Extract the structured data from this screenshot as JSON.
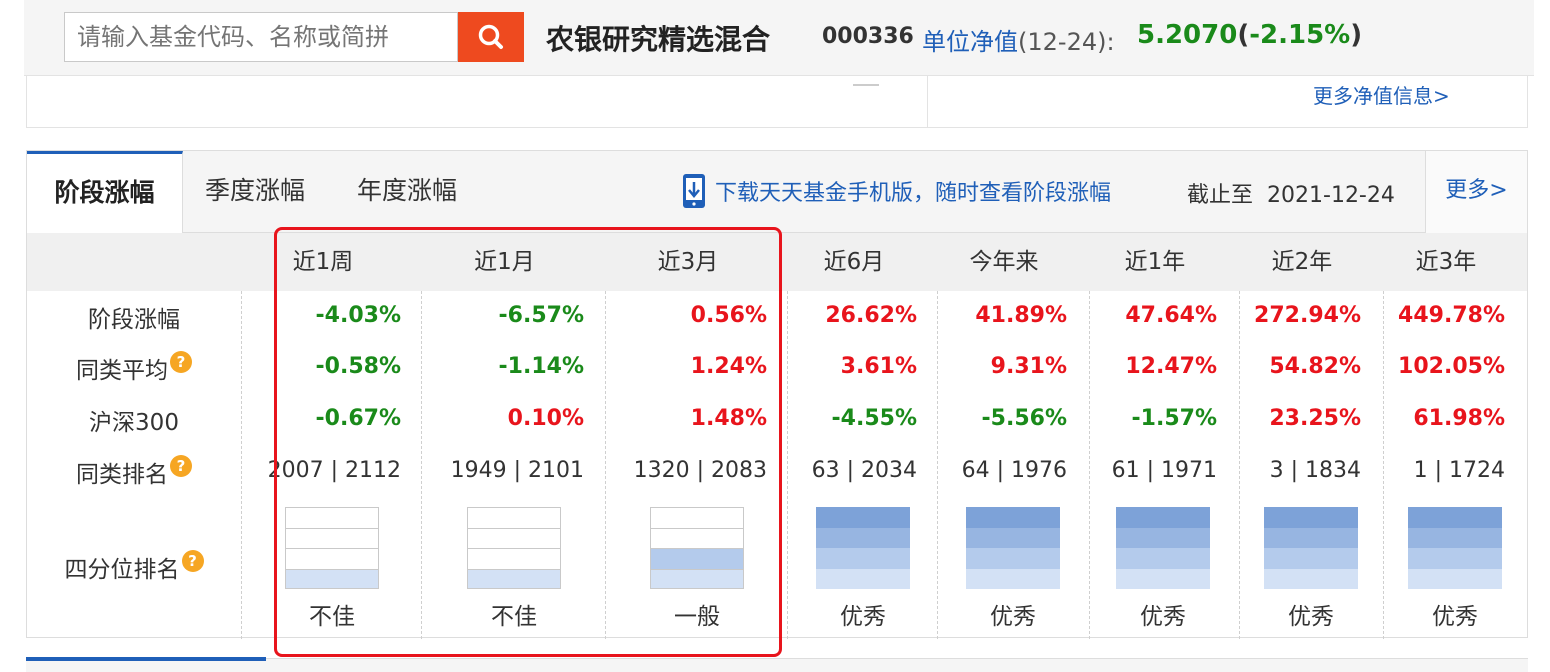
{
  "search": {
    "placeholder": "请输入基金代码、名称或简拼",
    "button_icon": "search-icon"
  },
  "fund": {
    "name": "农银研究精选混合",
    "code": "000336",
    "nav_label": "单位净值",
    "nav_date": "(12-24)",
    "nav_colon": ":",
    "nav_value": "5.2070",
    "nav_change_open": "(",
    "nav_change": "-2.15%",
    "nav_change_close": ")"
  },
  "upper": {
    "more_nav": "更多净值信息>"
  },
  "tabs": [
    {
      "label": "阶段涨幅",
      "active": true
    },
    {
      "label": "季度涨幅",
      "active": false
    },
    {
      "label": "年度涨幅",
      "active": false
    }
  ],
  "download_link": "下载天天基金手机版，随时查看阶段涨幅",
  "deadline_label": "截止至",
  "deadline_date": "2021-12-24",
  "more_label": "更多>",
  "columns": [
    "近1周",
    "近1月",
    "近3月",
    "近6月",
    "今年来",
    "近1年",
    "近2年",
    "近3年"
  ],
  "rows": {
    "stage": {
      "label": "阶段涨幅",
      "values": [
        "-4.03%",
        "-6.57%",
        "0.56%",
        "26.62%",
        "41.89%",
        "47.64%",
        "272.94%",
        "449.78%"
      ]
    },
    "avg": {
      "label": "同类平均",
      "values": [
        "-0.58%",
        "-1.14%",
        "1.24%",
        "3.61%",
        "9.31%",
        "12.47%",
        "54.82%",
        "102.05%"
      ]
    },
    "hs300": {
      "label": "沪深300",
      "values": [
        "-0.67%",
        "0.10%",
        "1.48%",
        "-4.55%",
        "-5.56%",
        "-1.57%",
        "23.25%",
        "61.98%"
      ]
    },
    "rank": {
      "label": "同类排名",
      "values": [
        "2007 | 2112",
        "1949 | 2101",
        "1320 | 2083",
        "63 | 2034",
        "64 | 1976",
        "61 | 1971",
        "3 | 1834",
        "1 | 1724"
      ]
    },
    "quartile": {
      "label": "四分位排名",
      "values": [
        "不佳",
        "不佳",
        "一般",
        "优秀",
        "优秀",
        "优秀",
        "优秀",
        "优秀"
      ],
      "levels": [
        1,
        1,
        2,
        4,
        4,
        4,
        4,
        4
      ]
    }
  },
  "help_icon_glyph": "?",
  "colors": {
    "positive": "#e8141c",
    "negative": "#1a8a1a",
    "link": "#1f5fb8",
    "accent": "#ee4a1f"
  }
}
